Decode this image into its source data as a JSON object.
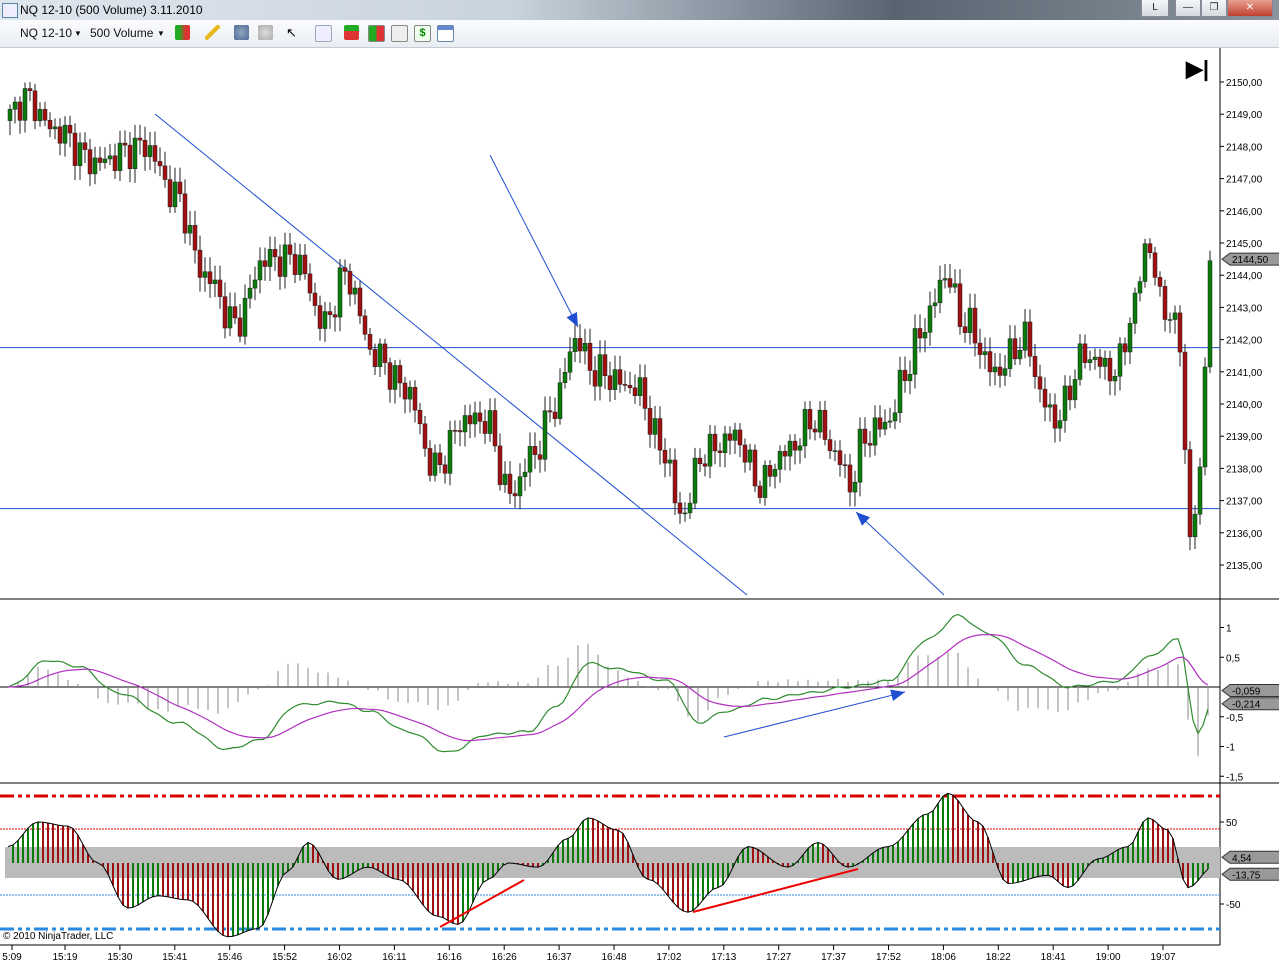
{
  "window": {
    "title": "NQ 12-10 (500 Volume)  3.11.2010",
    "btn_l": "L",
    "btn_min": "—",
    "btn_max": "❐",
    "btn_close": "✕"
  },
  "toolbar": {
    "instrument": "NQ 12-10",
    "period": "500 Volume",
    "icons": [
      "chart-style-icon",
      "pencil-icon",
      "zoom-in-icon",
      "zoom-out-icon",
      "pointer-icon",
      "magnifier-icon",
      "strategies-icon",
      "candles-icon",
      "indicators-icon",
      "dollar-icon",
      "properties-icon"
    ]
  },
  "price_axis": {
    "labels": [
      "2150,00",
      "2149,00",
      "2148,00",
      "2147,00",
      "2146,00",
      "2145,00",
      "2144,00",
      "2143,00",
      "2142,00",
      "2141,00",
      "2140,00",
      "2139,00",
      "2138,00",
      "2137,00",
      "2136,00",
      "2135,00"
    ],
    "values": [
      2150,
      2149,
      2148,
      2147,
      2146,
      2145,
      2144,
      2143,
      2142,
      2141,
      2140,
      2139,
      2138,
      2137,
      2136,
      2135
    ],
    "last": "2144,50",
    "last_value": 2144.5
  },
  "macd_axis": {
    "labels": [
      "1",
      "0,5",
      "-0,5",
      "-1",
      "-1,5"
    ],
    "values": [
      1,
      0.5,
      -0.5,
      -1,
      -1.5
    ],
    "tag1": "-0,059",
    "tag2": "-0,214"
  },
  "osc_axis": {
    "labels": [
      "50",
      "-50"
    ],
    "values": [
      50,
      -50
    ],
    "tag1": "4,54",
    "tag2": "-13,75"
  },
  "time_axis": [
    "5:09",
    "15:19",
    "15:30",
    "15:41",
    "15:46",
    "15:52",
    "16:02",
    "16:11",
    "16:16",
    "16:26",
    "16:37",
    "16:48",
    "17:02",
    "17:13",
    "17:27",
    "17:37",
    "17:52",
    "18:06",
    "18:22",
    "18:41",
    "19:00",
    "19:07"
  ],
  "copyright": "© 2010 NinjaTrader, LLC",
  "colors": {
    "up": "#0a7a0a",
    "down": "#a01010",
    "line": "#1f4fd0",
    "macd": "#2e8b2e",
    "signal": "#b030c0"
  },
  "chart_data": {
    "type": "candlestick",
    "bars": 241,
    "price_keypoints": [
      [
        0,
        2148.8
      ],
      [
        4,
        2149.5
      ],
      [
        10,
        2148.5
      ],
      [
        18,
        2147.5
      ],
      [
        28,
        2148
      ],
      [
        34,
        2146.5
      ],
      [
        40,
        2144
      ],
      [
        46,
        2142.5
      ],
      [
        52,
        2144.5
      ],
      [
        58,
        2144.5
      ],
      [
        64,
        2142.5
      ],
      [
        68,
        2144
      ],
      [
        74,
        2141.5
      ],
      [
        80,
        2140.5
      ],
      [
        86,
        2138
      ],
      [
        92,
        2139.5
      ],
      [
        96,
        2139.5
      ],
      [
        101,
        2137.2
      ],
      [
        106,
        2138.5
      ],
      [
        110,
        2140
      ],
      [
        114,
        2142
      ],
      [
        118,
        2141
      ],
      [
        126,
        2140.5
      ],
      [
        132,
        2138.5
      ],
      [
        135,
        2136.5
      ],
      [
        140,
        2138.5
      ],
      [
        146,
        2139
      ],
      [
        151,
        2137.5
      ],
      [
        156,
        2138.5
      ],
      [
        162,
        2139.5
      ],
      [
        166,
        2138.5
      ],
      [
        169,
        2137.5
      ],
      [
        172,
        2139
      ],
      [
        177,
        2139.5
      ],
      [
        180,
        2141
      ],
      [
        184,
        2142.5
      ],
      [
        188,
        2144
      ],
      [
        192,
        2142.5
      ],
      [
        198,
        2141
      ],
      [
        204,
        2142
      ],
      [
        208,
        2140
      ],
      [
        210,
        2139.5
      ],
      [
        216,
        2141.5
      ],
      [
        222,
        2141
      ],
      [
        226,
        2143
      ],
      [
        228,
        2145
      ],
      [
        232,
        2143
      ],
      [
        235,
        2142
      ],
      [
        237,
        2135.5
      ],
      [
        239,
        2138
      ],
      [
        241,
        2144.5
      ]
    ],
    "macd_keypoints": [
      [
        0,
        0
      ],
      [
        8,
        0.45
      ],
      [
        14,
        0.35
      ],
      [
        22,
        -0.1
      ],
      [
        34,
        -0.6
      ],
      [
        44,
        -1.05
      ],
      [
        50,
        -0.9
      ],
      [
        58,
        -0.3
      ],
      [
        66,
        -0.25
      ],
      [
        72,
        -0.4
      ],
      [
        80,
        -0.75
      ],
      [
        88,
        -1.1
      ],
      [
        96,
        -0.8
      ],
      [
        104,
        -0.75
      ],
      [
        110,
        -0.3
      ],
      [
        116,
        0.4
      ],
      [
        122,
        0.3
      ],
      [
        132,
        0.1
      ],
      [
        138,
        -0.6
      ],
      [
        144,
        -0.4
      ],
      [
        152,
        -0.2
      ],
      [
        160,
        -0.1
      ],
      [
        168,
        0
      ],
      [
        176,
        0.1
      ],
      [
        184,
        0.8
      ],
      [
        190,
        1.2
      ],
      [
        196,
        0.9
      ],
      [
        204,
        0.35
      ],
      [
        212,
        0
      ],
      [
        222,
        0.1
      ],
      [
        228,
        0.5
      ],
      [
        234,
        0.8
      ],
      [
        238,
        -0.8
      ],
      [
        241,
        -0.2
      ]
    ],
    "osc_keypoints": [
      [
        0,
        20
      ],
      [
        6,
        50
      ],
      [
        12,
        45
      ],
      [
        18,
        0
      ],
      [
        24,
        -55
      ],
      [
        30,
        -40
      ],
      [
        36,
        -45
      ],
      [
        44,
        -90
      ],
      [
        50,
        -80
      ],
      [
        56,
        -10
      ],
      [
        60,
        25
      ],
      [
        66,
        -20
      ],
      [
        72,
        -5
      ],
      [
        78,
        -20
      ],
      [
        86,
        -65
      ],
      [
        90,
        -75
      ],
      [
        96,
        -20
      ],
      [
        100,
        0
      ],
      [
        106,
        -5
      ],
      [
        112,
        30
      ],
      [
        116,
        55
      ],
      [
        122,
        40
      ],
      [
        128,
        -20
      ],
      [
        136,
        -60
      ],
      [
        142,
        -30
      ],
      [
        148,
        20
      ],
      [
        156,
        -5
      ],
      [
        162,
        25
      ],
      [
        168,
        -5
      ],
      [
        176,
        20
      ],
      [
        184,
        60
      ],
      [
        188,
        85
      ],
      [
        194,
        50
      ],
      [
        200,
        -25
      ],
      [
        208,
        -15
      ],
      [
        212,
        -30
      ],
      [
        218,
        5
      ],
      [
        224,
        20
      ],
      [
        228,
        55
      ],
      [
        232,
        40
      ],
      [
        236,
        -30
      ],
      [
        241,
        -5
      ]
    ]
  }
}
